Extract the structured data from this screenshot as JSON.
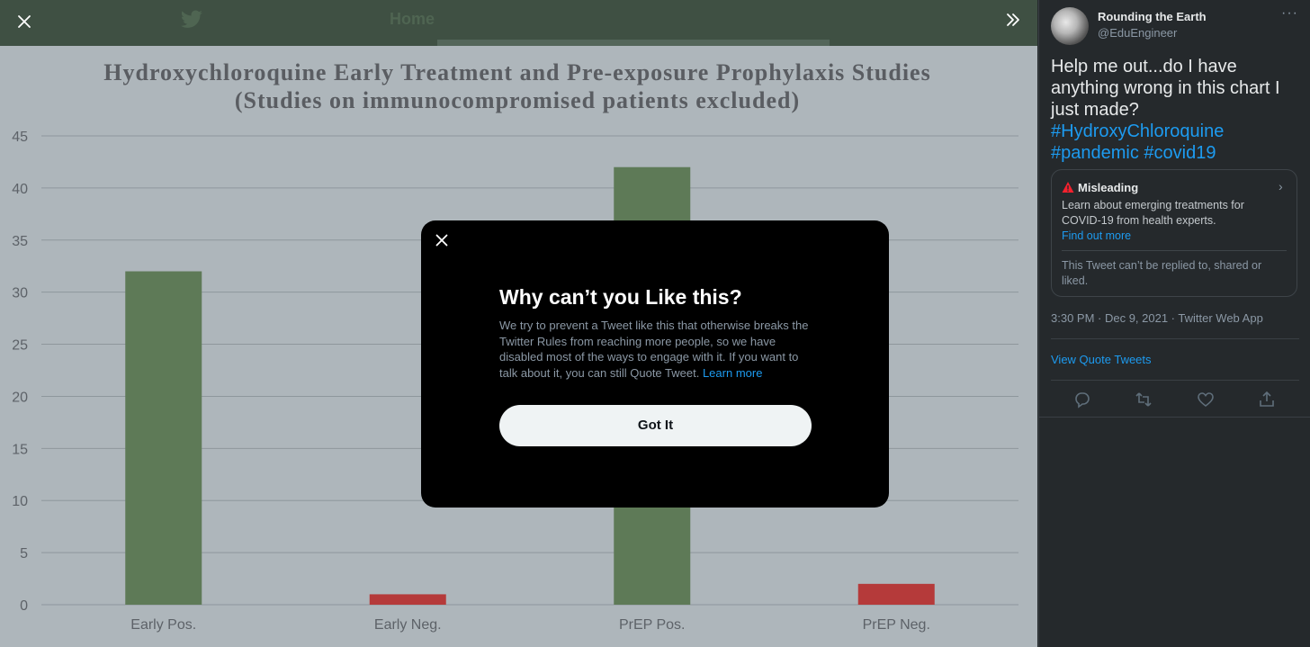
{
  "viewer": {
    "topbar_home": "Home",
    "close_icon": "close-icon",
    "expand_icon": "chevron-double-right-icon"
  },
  "chart_data": {
    "type": "bar",
    "title_line1": "Hydroxychloroquine Early Treatment and Pre-exposure Prophylaxis Studies",
    "title_line2": "(Studies on immunocompromised patients excluded)",
    "categories": [
      "Early Pos.",
      "Early Neg.",
      "PrEP Pos.",
      "PrEP Neg."
    ],
    "values": [
      32,
      1,
      42,
      2
    ],
    "bar_colors": [
      "#5e7a57",
      "#b53a3a",
      "#5e7a57",
      "#b53a3a"
    ],
    "ylim": [
      0,
      45
    ],
    "yticks": [
      0,
      5,
      10,
      15,
      20,
      25,
      30,
      35,
      40,
      45
    ],
    "grid": true,
    "background": "#aeb6bb"
  },
  "modal": {
    "title": "Why can’t you Like this?",
    "body": "We try to prevent a Tweet like this that otherwise breaks the Twitter Rules from reaching more people, so we have disabled most of the ways to engage with it. If you want to talk about it, you can still Quote Tweet.",
    "learn_more": "Learn more",
    "button": "Got It"
  },
  "tweet": {
    "author_name": "Rounding the Earth",
    "author_handle": "@EduEngineer",
    "more": "···",
    "text": "Help me out...do I have anything wrong in this chart I just made?",
    "hashtags": [
      "#HydroxyChloroquine",
      "#pandemic",
      "#covid19"
    ],
    "notice": {
      "label": "Misleading",
      "text": "Learn about emerging treatments for COVID-19 from health experts.",
      "link": "Find out more",
      "cant_reply": "This Tweet can’t be replied to, shared or liked."
    },
    "timestamp": "3:30 PM · Dec 9, 2021 · Twitter Web App",
    "quote_link": "View Quote Tweets",
    "actions": [
      "reply-icon",
      "retweet-icon",
      "like-icon",
      "share-icon"
    ]
  },
  "colors": {
    "accent": "#1d9bf0",
    "panel_bg": "#25292c",
    "positive_bar": "#5e7a57",
    "negative_bar": "#b53a3a"
  }
}
